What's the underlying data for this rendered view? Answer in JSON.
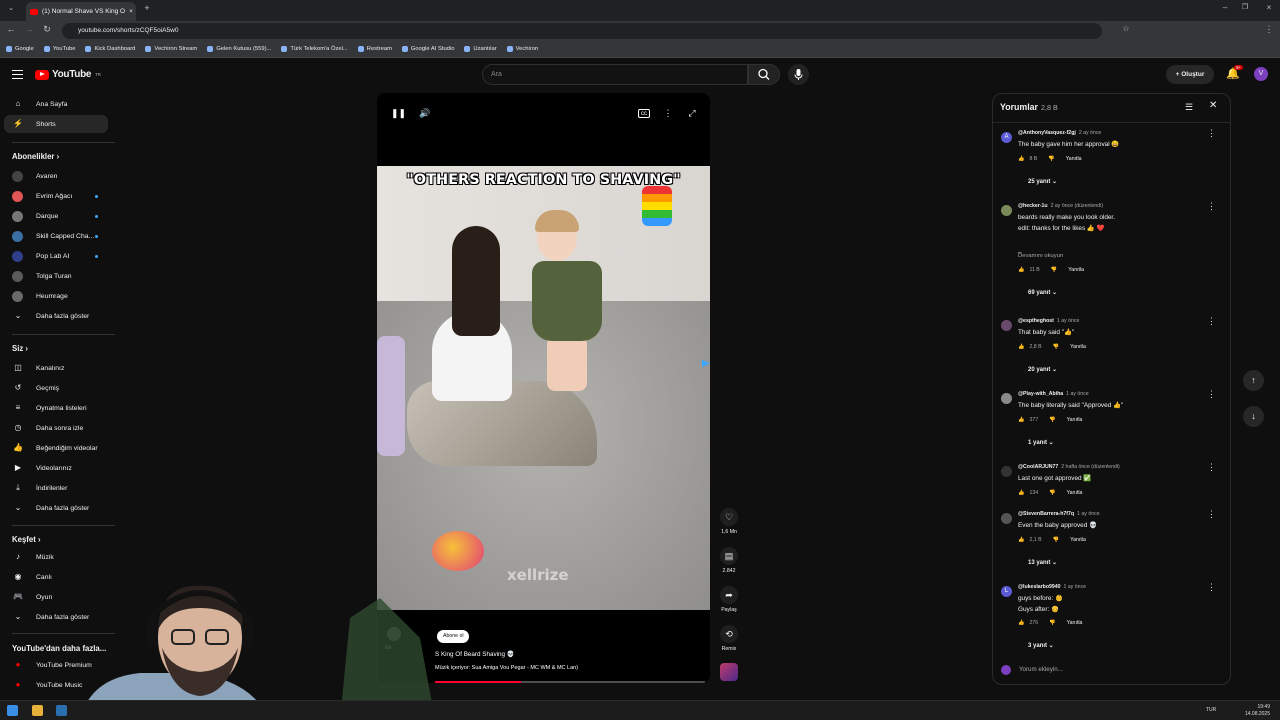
{
  "browser": {
    "tab_title": "(1) Normal Shave VS King O",
    "url": "youtube.com/shorts/zCQF5oiA5w0",
    "bookmarks": [
      "Google",
      "YouTube",
      "Kick Dashboard",
      "Vechiron Stream",
      "Gelen Kutusu (559)...",
      "Türk Telekom'a Özel...",
      "Restream",
      "Google AI Studio",
      "Uzantılar",
      "Vechiron"
    ]
  },
  "header": {
    "logo_text": "YouTube",
    "logo_region": "TR",
    "search_placeholder": "Ara",
    "create_label": "Oluştur",
    "notification_count": "9+"
  },
  "sidebar": {
    "main": [
      {
        "label": "Ana Sayfa",
        "icon": "home-icon"
      },
      {
        "label": "Shorts",
        "icon": "shorts-icon"
      }
    ],
    "subscriptions_title": "Abonelikler",
    "subscriptions": [
      {
        "label": "Avaren",
        "color": "#444444",
        "dot": false
      },
      {
        "label": "Evrim Ağacı",
        "color": "#e05555",
        "dot": true
      },
      {
        "label": "Darque",
        "color": "#777777",
        "dot": true
      },
      {
        "label": "Skill Capped Cha...",
        "color": "#3a6ea5",
        "dot": true
      },
      {
        "label": "Pop Lab AI",
        "color": "#2f3f8a",
        "dot": true
      },
      {
        "label": "Tolga Turan",
        "color": "#5a5a5a",
        "dot": false
      },
      {
        "label": "Heumrage",
        "color": "#6a6a6a",
        "dot": false
      }
    ],
    "show_more": "Daha fazla göster",
    "you_title": "Siz",
    "you": [
      {
        "label": "Kanalınız",
        "icon": "channel-icon"
      },
      {
        "label": "Geçmiş",
        "icon": "history-icon"
      },
      {
        "label": "Oynatma listeleri",
        "icon": "playlist-icon"
      },
      {
        "label": "Daha sonra izle",
        "icon": "clock-icon"
      },
      {
        "label": "Beğendiğim videolar",
        "icon": "thumb-up-icon"
      },
      {
        "label": "Videolarınız",
        "icon": "video-icon"
      },
      {
        "label": "İndirilenler",
        "icon": "download-icon"
      }
    ],
    "explore_title": "Keşfet",
    "explore": [
      {
        "label": "Müzik",
        "icon": "music-icon"
      },
      {
        "label": "Canlı",
        "icon": "live-icon"
      },
      {
        "label": "Oyun",
        "icon": "gamepad-icon"
      }
    ],
    "more_title": "YouTube'dan daha fazla...",
    "more": [
      {
        "label": "YouTube Premium",
        "icon": "yt-premium-icon"
      },
      {
        "label": "YouTube Music",
        "icon": "yt-music-icon"
      }
    ]
  },
  "player": {
    "caption": "\"OTHERS REACTION TO SHAVING\"",
    "watermark": "xellrize",
    "channel_short": "No",
    "subscribe": "Abone ol",
    "title": "S King Of Beard Shaving 💀",
    "music": "Müzik içeriyor: Sua Amiga Vou Pegar - MC WM & MC Lan)",
    "progress": 0.32
  },
  "actions": {
    "likes": "1,6 Mn",
    "comments": "2.842",
    "share": "Paylaş",
    "remix": "Remix"
  },
  "comments": {
    "title": "Yorumlar",
    "count": "2,8 B",
    "items": [
      {
        "author": "@AnthonyVasquez-f2gj",
        "time": "2 ay önce",
        "text": "The baby gave him her approval 😄",
        "likes": "8 B",
        "reply": "Yanıtla",
        "replies": "25 yanıt",
        "avatar": "A",
        "color": "#5b5bd6"
      },
      {
        "author": "@hecker-1u",
        "time": "2 ay önce (düzenlendi)",
        "text": "beards really make you look older.\nedit: thanks for the likes 👍 ❤️\n\n_",
        "readmore": "Devamını okuyun",
        "likes": "11 B",
        "reply": "Yanıtla",
        "replies": "69 yanıt",
        "avatar": "",
        "color": "#7a8a5a"
      },
      {
        "author": "@esptheghost",
        "time": "1 ay önce",
        "text": "That baby said \"👍\"",
        "likes": "2,8 B",
        "reply": "Yanıtla",
        "replies": "20 yanıt",
        "avatar": "",
        "color": "#6a4a6a"
      },
      {
        "author": "@Play-with_Abiha",
        "time": "1 ay önce",
        "text": "The baby literally said \"Approved 👍\"",
        "likes": "377",
        "reply": "Yanıtla",
        "replies": "1 yanıt",
        "avatar": "",
        "color": "#8a8a8a"
      },
      {
        "author": "@CoolARJUN77",
        "time": "2 hafta önce (düzenlendi)",
        "text": "Last one got approved ✅",
        "likes": "134",
        "reply": "Yanıtla",
        "replies": "",
        "avatar": "",
        "color": "#333333"
      },
      {
        "author": "@StevenBarrera-h7f7q",
        "time": "1 ay önce",
        "text": "Even the baby approved 💀",
        "likes": "2,1 B",
        "reply": "Yanıtla",
        "replies": "13 yanıt",
        "avatar": "",
        "color": "#555555"
      },
      {
        "author": "@lukeslarbo9940",
        "time": "1 ay önce",
        "text": "guys before: 👶\nGuys after: 👴",
        "likes": "276",
        "reply": "Yanıtla",
        "replies": "3 yanıt",
        "avatar": "L",
        "color": "#5b5bd6"
      }
    ],
    "add_placeholder": "Yorum ekleyin..."
  },
  "taskbar": {
    "lang": "TUR",
    "time": "19:49",
    "date": "14.08.2025"
  }
}
